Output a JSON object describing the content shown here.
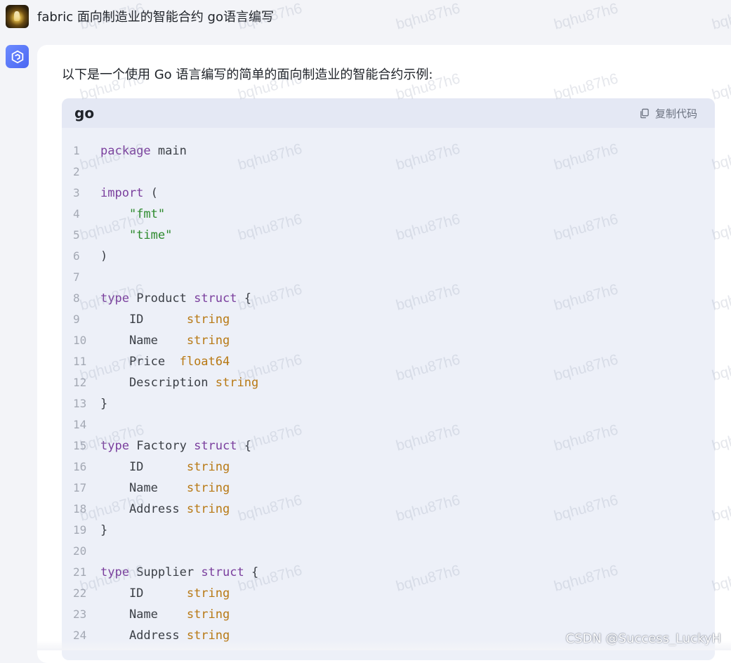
{
  "user_message": {
    "text": "fabric 面向制造业的智能合约 go语言编写"
  },
  "answer": {
    "intro": "以下是一个使用 Go 语言编写的简单的面向制造业的智能合约示例:",
    "code_block": {
      "language": "go",
      "copy_label": "复制代码",
      "lines": [
        {
          "n": "1",
          "tokens": [
            {
              "t": "package",
              "c": "kw"
            },
            {
              "t": " main",
              "c": ""
            }
          ]
        },
        {
          "n": "2",
          "tokens": []
        },
        {
          "n": "3",
          "tokens": [
            {
              "t": "import",
              "c": "kw"
            },
            {
              "t": " (",
              "c": ""
            }
          ]
        },
        {
          "n": "4",
          "tokens": [
            {
              "t": "    ",
              "c": ""
            },
            {
              "t": "\"fmt\"",
              "c": "str"
            }
          ]
        },
        {
          "n": "5",
          "tokens": [
            {
              "t": "    ",
              "c": ""
            },
            {
              "t": "\"time\"",
              "c": "str"
            }
          ]
        },
        {
          "n": "6",
          "tokens": [
            {
              "t": ")",
              "c": ""
            }
          ]
        },
        {
          "n": "7",
          "tokens": []
        },
        {
          "n": "8",
          "tokens": [
            {
              "t": "type",
              "c": "kw"
            },
            {
              "t": " Product ",
              "c": ""
            },
            {
              "t": "struct",
              "c": "kw"
            },
            {
              "t": " {",
              "c": ""
            }
          ]
        },
        {
          "n": "9",
          "tokens": [
            {
              "t": "    ID      ",
              "c": ""
            },
            {
              "t": "string",
              "c": "ty"
            }
          ]
        },
        {
          "n": "10",
          "tokens": [
            {
              "t": "    Name    ",
              "c": ""
            },
            {
              "t": "string",
              "c": "ty"
            }
          ]
        },
        {
          "n": "11",
          "tokens": [
            {
              "t": "    Price  ",
              "c": ""
            },
            {
              "t": "float64",
              "c": "ty"
            }
          ]
        },
        {
          "n": "12",
          "tokens": [
            {
              "t": "    Description ",
              "c": ""
            },
            {
              "t": "string",
              "c": "ty"
            }
          ]
        },
        {
          "n": "13",
          "tokens": [
            {
              "t": "}",
              "c": ""
            }
          ]
        },
        {
          "n": "14",
          "tokens": []
        },
        {
          "n": "15",
          "tokens": [
            {
              "t": "type",
              "c": "kw"
            },
            {
              "t": " Factory ",
              "c": ""
            },
            {
              "t": "struct",
              "c": "kw"
            },
            {
              "t": " {",
              "c": ""
            }
          ]
        },
        {
          "n": "16",
          "tokens": [
            {
              "t": "    ID      ",
              "c": ""
            },
            {
              "t": "string",
              "c": "ty"
            }
          ]
        },
        {
          "n": "17",
          "tokens": [
            {
              "t": "    Name    ",
              "c": ""
            },
            {
              "t": "string",
              "c": "ty"
            }
          ]
        },
        {
          "n": "18",
          "tokens": [
            {
              "t": "    Address ",
              "c": ""
            },
            {
              "t": "string",
              "c": "ty"
            }
          ]
        },
        {
          "n": "19",
          "tokens": [
            {
              "t": "}",
              "c": ""
            }
          ]
        },
        {
          "n": "20",
          "tokens": []
        },
        {
          "n": "21",
          "tokens": [
            {
              "t": "type",
              "c": "kw"
            },
            {
              "t": " Supplier ",
              "c": ""
            },
            {
              "t": "struct",
              "c": "kw"
            },
            {
              "t": " {",
              "c": ""
            }
          ]
        },
        {
          "n": "22",
          "tokens": [
            {
              "t": "    ID      ",
              "c": ""
            },
            {
              "t": "string",
              "c": "ty"
            }
          ]
        },
        {
          "n": "23",
          "tokens": [
            {
              "t": "    Name    ",
              "c": ""
            },
            {
              "t": "string",
              "c": "ty"
            }
          ]
        },
        {
          "n": "24",
          "tokens": [
            {
              "t": "    Address ",
              "c": ""
            },
            {
              "t": "string",
              "c": "ty"
            }
          ]
        }
      ]
    }
  },
  "watermark_text": "bqhu87h6",
  "footer_watermark": "CSDN @Success_LuckyH",
  "colors": {
    "keyword": "#7a3e9d",
    "string_literal": "#2d8a2d",
    "type": "#b87914",
    "accent": "#4b67f2"
  },
  "icons": {
    "copy": "copy-icon",
    "bot": "bot-logo-icon",
    "user": "user-avatar"
  }
}
